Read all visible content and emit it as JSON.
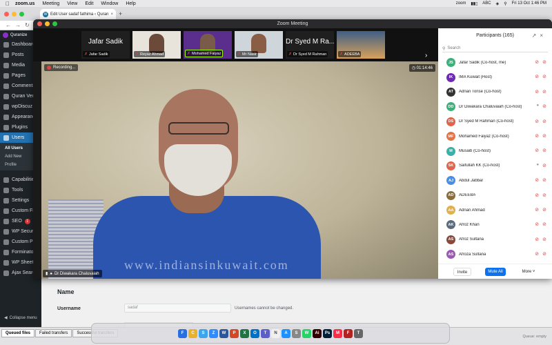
{
  "menubar": {
    "app": "zoom.us",
    "items": [
      "Meeting",
      "View",
      "Edit",
      "Window",
      "Help"
    ],
    "status_zoom": "zoom",
    "keyboard": "ABC",
    "datetime": "Fri 13 Oct  1:46 PM"
  },
  "browser": {
    "tab_title": "Edit User sadaf fathima ‹ Quran",
    "new_tab": "+"
  },
  "wp": {
    "site_name": "Quranize",
    "menu": [
      {
        "label": "Dashboard",
        "icon": "dashboard-icon"
      },
      {
        "label": "Posts",
        "icon": "pin-icon"
      },
      {
        "label": "Media",
        "icon": "media-icon"
      },
      {
        "label": "Pages",
        "icon": "page-icon"
      },
      {
        "label": "Comments",
        "icon": "comment-icon"
      },
      {
        "label": "Quran Verses",
        "icon": "book-icon"
      },
      {
        "label": "wpDiscuz",
        "icon": "discuss-icon"
      },
      {
        "label": "Appearance",
        "icon": "brush-icon"
      },
      {
        "label": "Plugins",
        "icon": "plugin-icon"
      },
      {
        "label": "Users",
        "icon": "users-icon"
      }
    ],
    "users_sub": [
      "All Users",
      "Add New",
      "Profile"
    ],
    "menu2": [
      {
        "label": "Capabilities",
        "icon": "key-icon"
      },
      {
        "label": "Tools",
        "icon": "wrench-icon"
      },
      {
        "label": "Settings",
        "icon": "settings-icon"
      },
      {
        "label": "Custom Fields",
        "icon": "fields-icon"
      },
      {
        "label": "SEO",
        "icon": "seo-icon",
        "badge": "1"
      },
      {
        "label": "WP Security",
        "icon": "shield-icon"
      },
      {
        "label": "Custom Permalinks",
        "icon": "link-icon"
      },
      {
        "label": "Forminator",
        "icon": "form-icon"
      },
      {
        "label": "WP Sheet Editor",
        "icon": "sheet-icon"
      },
      {
        "label": "Ajax Search Lite",
        "icon": "search-icon"
      }
    ],
    "collapse": "Collapse menu",
    "section_title": "Name",
    "username_label": "Username",
    "username_value": "sadaf",
    "username_help": "Usernames cannot be changed."
  },
  "zoom": {
    "title": "Zoom Meeting",
    "strip": [
      {
        "big": "Jafar Sadik",
        "name": "Jafar Sadik"
      },
      {
        "big": "",
        "name": "Reyaz Ahmad"
      },
      {
        "big": "",
        "name": "Mohamed Faiyaz"
      },
      {
        "big": "",
        "name": "Mr Nasir"
      },
      {
        "big": "Dr Syed M Ra...",
        "name": "Dr Syed M Rahman"
      },
      {
        "big": "",
        "name": "ADEEBA"
      }
    ],
    "recording": "Recording...",
    "timer": "01:14:46",
    "speaker": "Dr Diwakara Chaluvaiah",
    "watermark": "www.indiansinkuwait.com"
  },
  "participants": {
    "title": "Participants (165)",
    "search_placeholder": "Search",
    "list": [
      {
        "initials": "JS",
        "color": "#3bb07a",
        "name": "Jafar Sadik (Co-host, me)",
        "muted": true
      },
      {
        "initials": "IK",
        "color": "#6d2bb5",
        "name": "IMA Kuwait (Host)",
        "muted": true
      },
      {
        "initials": "AT",
        "color": "#333333",
        "name": "Adnan Tonse (Co-host)",
        "muted": true
      },
      {
        "initials": "DD",
        "color": "#3bb07a",
        "name": "Dr Diwakara Chaluvaiah  (Co-host)",
        "muted": false
      },
      {
        "initials": "DS",
        "color": "#e2624a",
        "name": "Dr Syed M Rahman (Co-host)",
        "muted": true
      },
      {
        "initials": "MF",
        "color": "#e2744a",
        "name": "Mohamed Faiyaz (Co-host)",
        "muted": true
      },
      {
        "initials": "M",
        "color": "#3bb0a6",
        "name": "Musaib (Co-host)",
        "muted": true
      },
      {
        "initials": "SK",
        "color": "#e2624a",
        "name": "Saifullah KK (Co-host)",
        "muted": false
      },
      {
        "initials": "AJ",
        "color": "#4a8de2",
        "name": "Abdul Jabbar",
        "muted": true
      },
      {
        "initials": "AD",
        "color": "#8a6d3b",
        "name": "ADEEBA",
        "muted": true
      },
      {
        "initials": "AA",
        "color": "#e2b04a",
        "name": "Adnan Ahmad",
        "muted": true
      },
      {
        "initials": "AK",
        "color": "#5a6b7c",
        "name": "Afroz Khan",
        "muted": true
      },
      {
        "initials": "AS",
        "color": "#8a4a3b",
        "name": "Afroz Sultana",
        "muted": true
      },
      {
        "initials": "AS",
        "color": "#9b59b6",
        "name": "Afroza Sultana",
        "muted": true
      }
    ],
    "invite": "Invite",
    "mute_all": "Mute All",
    "more": "More"
  },
  "bottom": {
    "tabs": [
      "Queued files",
      "Failed transfers",
      "Successful transfers"
    ],
    "queue": "Queue: empty"
  },
  "dock": [
    {
      "label": "F",
      "color": "#2b6ee0",
      "icon": "finder-icon"
    },
    {
      "label": "C",
      "color": "#e8b230",
      "icon": "chrome-icon"
    },
    {
      "label": "S",
      "color": "#3da5f0",
      "icon": "safari-icon"
    },
    {
      "label": "Z",
      "color": "#2d8cff",
      "icon": "zoom-icon"
    },
    {
      "label": "W",
      "color": "#2b579a",
      "icon": "word-icon"
    },
    {
      "label": "P",
      "color": "#d24726",
      "icon": "powerpoint-icon"
    },
    {
      "label": "X",
      "color": "#217346",
      "icon": "excel-icon"
    },
    {
      "label": "O",
      "color": "#0072c6",
      "icon": "outlook-icon"
    },
    {
      "label": "T",
      "color": "#5b5fc7",
      "icon": "teams-icon"
    },
    {
      "label": "N",
      "color": "#f0f0f0",
      "icon": "notes-icon"
    },
    {
      "label": "A",
      "color": "#1e90ff",
      "icon": "appstore-icon"
    },
    {
      "label": "S",
      "color": "#888888",
      "icon": "settings-icon"
    },
    {
      "label": "W",
      "color": "#25d366",
      "icon": "whatsapp-icon"
    },
    {
      "label": "Ai",
      "color": "#330000",
      "icon": "illustrator-icon"
    },
    {
      "label": "Ps",
      "color": "#001e36",
      "icon": "photoshop-icon"
    },
    {
      "label": "M",
      "color": "#fa2d48",
      "icon": "music-icon"
    },
    {
      "label": "F",
      "color": "#b22222",
      "icon": "filezilla-icon"
    },
    {
      "label": "T",
      "color": "#666666",
      "icon": "trash-icon"
    }
  ]
}
